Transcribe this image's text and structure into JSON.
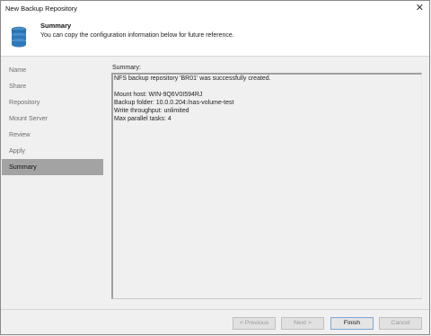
{
  "window": {
    "title": "New Backup Repository",
    "close_glyph": "✕"
  },
  "header": {
    "title": "Summary",
    "subtitle": "You can copy the configuration information below for future reference.",
    "icon": "database-icon"
  },
  "steps": [
    {
      "label": "Name",
      "active": false
    },
    {
      "label": "Share",
      "active": false
    },
    {
      "label": "Repository",
      "active": false
    },
    {
      "label": "Mount Server",
      "active": false
    },
    {
      "label": "Review",
      "active": false
    },
    {
      "label": "Apply",
      "active": false
    },
    {
      "label": "Summary",
      "active": true
    }
  ],
  "summary": {
    "label": "Summary:",
    "lines": [
      "NFS backup repository 'BR01' was successfully created.",
      "",
      "Mount host: WIN-9Q6V0I594RJ",
      "Backup folder: 10.0.0.204:/nas-volume-test",
      "Write throughput: unlimited",
      "Max parallel tasks: 4"
    ]
  },
  "buttons": {
    "previous": "< Previous",
    "next": "Next >",
    "finish": "Finish",
    "cancel": "Cancel"
  },
  "colors": {
    "active_step_bg": "#a3a3a3",
    "icon_blue": "#2f79b9"
  }
}
